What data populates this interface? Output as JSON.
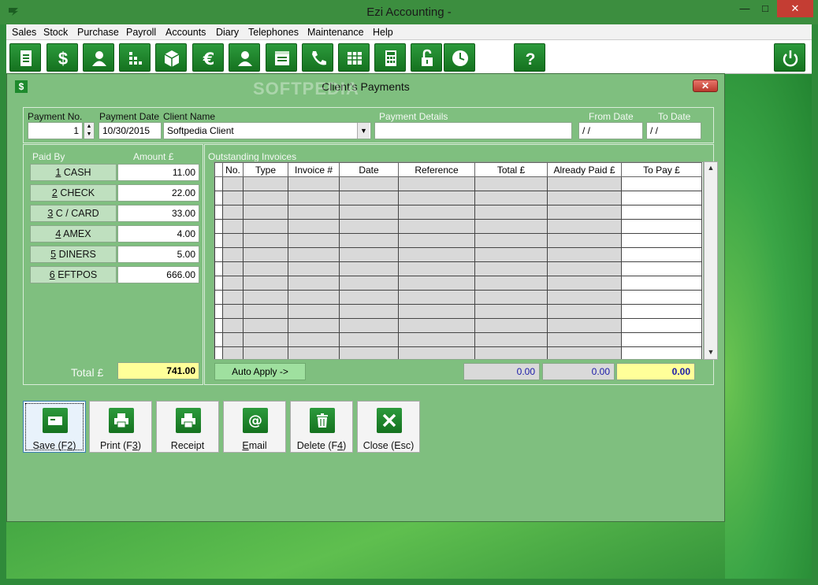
{
  "app": {
    "title": "Ezi Accounting -",
    "window_controls": {
      "minimize": "—",
      "maximize": "□",
      "close": "✕"
    }
  },
  "menu": [
    "Sales",
    "Stock",
    "Purchase",
    "Payroll",
    "Accounts",
    "Diary",
    "Telephones",
    "Maintenance",
    "Help"
  ],
  "toolbar_icons": [
    "document-icon",
    "dollar-icon",
    "person-icon",
    "grid-dots-icon",
    "box-icon",
    "euro-icon",
    "contact-icon",
    "ledger-icon",
    "phone-icon",
    "table-icon",
    "calculator-icon",
    "unlock-icon",
    "clock-icon",
    "help-icon",
    "power-icon"
  ],
  "watermark": "SOFTPEDIA",
  "dialog": {
    "title": "Client's Payments",
    "icon": "$",
    "close_label": "✕"
  },
  "header": {
    "payment_no_label": "Payment No.",
    "payment_no": "1",
    "payment_date_label": "Payment Date",
    "payment_date": "10/30/2015",
    "client_name_label": "Client Name",
    "client_name": "Softpedia Client",
    "payment_details_label": "Payment Details",
    "payment_details": "",
    "from_date_label": "From Date",
    "from_date": " / /",
    "to_date_label": "To Date",
    "to_date": " / /"
  },
  "paid_by": {
    "label": "Paid By",
    "amount_label": "Amount £",
    "methods": [
      {
        "key": "1",
        "name": " CASH",
        "amount": "11.00"
      },
      {
        "key": "2",
        "name": " CHECK",
        "amount": "22.00"
      },
      {
        "key": "3",
        "name": " C / CARD",
        "amount": "33.00"
      },
      {
        "key": "4",
        "name": " AMEX",
        "amount": "4.00"
      },
      {
        "key": "5",
        "name": " DINERS",
        "amount": "5.00"
      },
      {
        "key": "6",
        "name": " EFTPOS",
        "amount": "666.00"
      }
    ],
    "total_label": "Total £",
    "total": "741.00"
  },
  "invoices": {
    "label": "Outstanding Invoices",
    "columns": [
      "No.",
      "Type",
      "Invoice #",
      "Date",
      "Reference",
      "Total £",
      "Already Paid £",
      "To Pay £"
    ],
    "auto_apply": "Auto Apply ->",
    "sum_total": "0.00",
    "sum_already_paid": "0.00",
    "sum_to_pay": "0.00"
  },
  "actions": [
    {
      "pre": "Save (F",
      "key": "2",
      "post": ")",
      "icon": "card-icon"
    },
    {
      "pre": "Print (F",
      "key": "3",
      "post": ")",
      "icon": "printer-icon"
    },
    {
      "pre": "Receipt",
      "key": "",
      "post": "",
      "icon": "printer-icon"
    },
    {
      "pre": "",
      "key": "E",
      "post": "mail",
      "icon": "at-icon"
    },
    {
      "pre": "Delete (F",
      "key": "4",
      "post": ")",
      "icon": "trash-icon"
    },
    {
      "pre": "Close (Esc)",
      "key": "",
      "post": "",
      "icon": "x-icon"
    }
  ]
}
